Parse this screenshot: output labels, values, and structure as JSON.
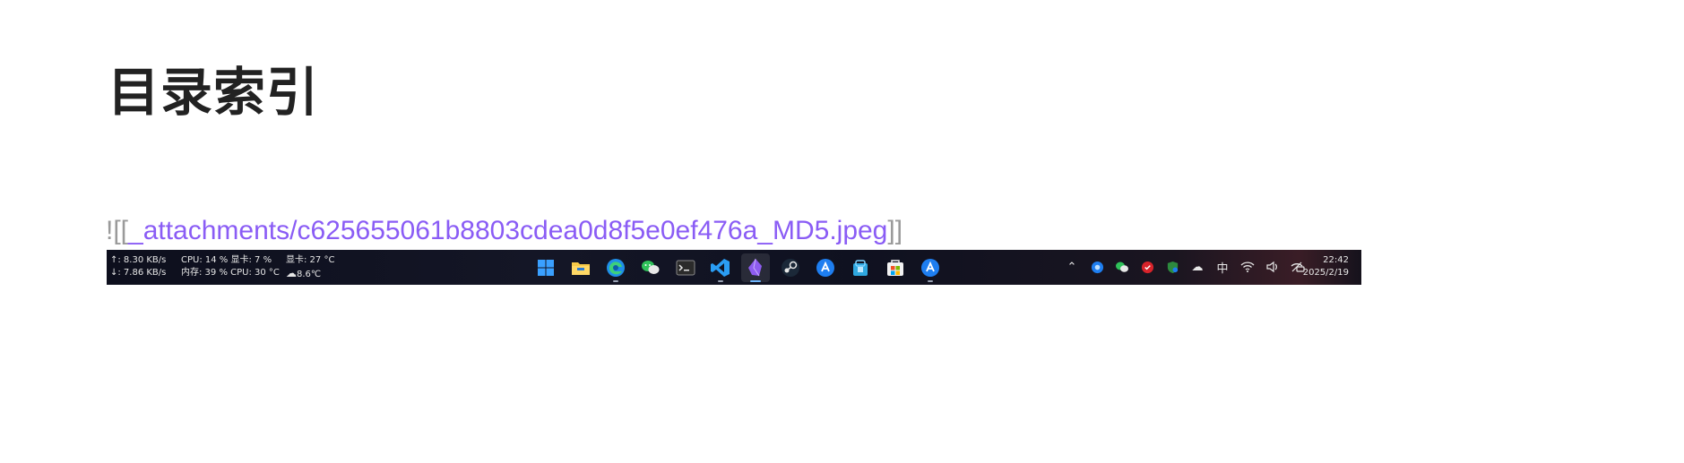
{
  "document": {
    "title": "目录索引",
    "embed": {
      "prefix": "![[",
      "link": "_attachments/c625655061b8803cdea0d8f5e0ef476a_MD5.jpeg",
      "suffix": "]]"
    }
  },
  "taskbar": {
    "net_up": "↑: 8.30 KB/s",
    "net_down": "↓: 7.86 KB/s",
    "cpu": "CPU: 14 %",
    "gpu": "显卡: 7 %",
    "gpu_temp": "显卡: 27 °C",
    "mem": "内存: 39 %",
    "cpu_temp": "CPU: 30 °C",
    "weather": "8.6℃",
    "apps": [
      {
        "name": "start",
        "icon": "windows-logo-icon",
        "active": false,
        "running": false
      },
      {
        "name": "file-explorer",
        "icon": "folder-icon",
        "active": false,
        "running": false
      },
      {
        "name": "edge",
        "icon": "edge-browser-icon",
        "active": false,
        "running": true
      },
      {
        "name": "wechat",
        "icon": "wechat-icon",
        "active": false,
        "running": false
      },
      {
        "name": "terminal",
        "icon": "terminal-icon",
        "active": false,
        "running": false
      },
      {
        "name": "vscode",
        "icon": "vscode-icon",
        "active": false,
        "running": true
      },
      {
        "name": "obsidian",
        "icon": "obsidian-icon",
        "active": true,
        "running": true
      },
      {
        "name": "steam",
        "icon": "steam-icon",
        "active": false,
        "running": false
      },
      {
        "name": "bilibili-like",
        "icon": "blue-circle-app-icon",
        "active": false,
        "running": false
      },
      {
        "name": "app-store-bag",
        "icon": "store-bag-icon",
        "active": false,
        "running": false
      },
      {
        "name": "microsoft-store",
        "icon": "microsoft-store-icon",
        "active": false,
        "running": false
      },
      {
        "name": "blue-app",
        "icon": "blue-circle-app-icon",
        "active": false,
        "running": true
      }
    ],
    "tray": {
      "ime": "中"
    },
    "time": "22:42",
    "date": "2025/2/19"
  }
}
